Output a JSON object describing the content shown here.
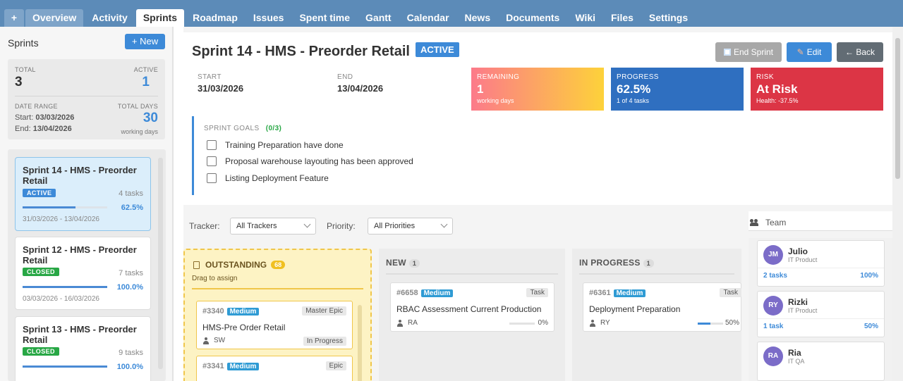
{
  "nav": {
    "plus": "+",
    "tabs": [
      "Overview",
      "Activity",
      "Sprints",
      "Roadmap",
      "Issues",
      "Spent time",
      "Gantt",
      "Calendar",
      "News",
      "Documents",
      "Wiki",
      "Files",
      "Settings"
    ]
  },
  "sidebar": {
    "title": "Sprints",
    "new_button": "+ New",
    "stats": {
      "total_label": "TOTAL",
      "total": "3",
      "active_label": "ACTIVE",
      "active": "1",
      "date_range_label": "DATE RANGE",
      "start_label": "Start:",
      "start": "03/03/2026",
      "end_label": "End:",
      "end": "13/04/2026",
      "total_days_label": "TOTAL DAYS",
      "total_days": "30",
      "working_days": "working days"
    },
    "sprints": [
      {
        "title": "Sprint 14 - HMS - Preorder Retail",
        "status": "ACTIVE",
        "tasks": "4 tasks",
        "progress": 62.5,
        "progress_text": "62.5%",
        "dates": "31/03/2026 - 13/04/2026"
      },
      {
        "title": "Sprint 12 - HMS - Preorder Retail",
        "status": "CLOSED",
        "tasks": "7 tasks",
        "progress": 100,
        "progress_text": "100.0%",
        "dates": "03/03/2026 - 16/03/2026"
      },
      {
        "title": "Sprint 13 - HMS - Preorder Retail",
        "status": "CLOSED",
        "tasks": "9 tasks",
        "progress": 100,
        "progress_text": "100.0%",
        "dates": ""
      }
    ]
  },
  "header": {
    "title": "Sprint 14 - HMS - Preorder Retail",
    "status": "ACTIVE",
    "end_sprint": "End Sprint",
    "edit": "Edit",
    "back": "← Back"
  },
  "info": {
    "start_label": "START",
    "start": "31/03/2026",
    "end_label": "END",
    "end": "13/04/2026",
    "remaining_label": "REMAINING",
    "remaining": "1",
    "remaining_sub": "working days",
    "progress_label": "PROGRESS",
    "progress": "62.5%",
    "progress_sub": "1 of 4 tasks",
    "risk_label": "RISK",
    "risk": "At Risk",
    "risk_sub": "Health: -37.5%"
  },
  "goals": {
    "label": "SPRINT GOALS",
    "count": "(0/3)",
    "items": [
      "Training Preparation have done",
      "Proposal warehouse layouting has been approved",
      "Listing Deployment Feature"
    ]
  },
  "filters": {
    "tracker_label": "Tracker:",
    "tracker": "All Trackers",
    "priority_label": "Priority:",
    "priority": "All Priorities"
  },
  "board": {
    "outstanding": {
      "title": "OUTSTANDING",
      "count": "68",
      "hint": "Drag to assign",
      "tasks": [
        {
          "id": "#3340",
          "priority": "Medium",
          "tracker": "Master Epic",
          "subject": "HMS-Pre Order Retail",
          "user": "SW",
          "status": "In Progress"
        },
        {
          "id": "#3341",
          "priority": "Medium",
          "tracker": "Epic"
        }
      ]
    },
    "new": {
      "title": "NEW",
      "count": "1",
      "task": {
        "id": "#6658",
        "priority": "Medium",
        "tracker": "Task",
        "subject": "RBAC Assessment Current Production",
        "user": "RA",
        "progress": 0,
        "progress_text": "0%"
      }
    },
    "in_progress": {
      "title": "IN PROGRESS",
      "count": "1",
      "task": {
        "id": "#6361",
        "priority": "Medium",
        "tracker": "Task",
        "subject": "Deployment Preparation",
        "user": "RY",
        "progress": 50,
        "progress_text": "50%"
      }
    }
  },
  "team": {
    "title": "Team",
    "members": [
      {
        "initials": "JM",
        "name": "Julio",
        "role": "IT Product",
        "tasks": "2 tasks",
        "pct": "100%"
      },
      {
        "initials": "RY",
        "name": "Rizki",
        "role": "IT Product",
        "tasks": "1 task",
        "pct": "50%"
      },
      {
        "initials": "RA",
        "name": "Ria",
        "role": "IT QA",
        "tasks": "",
        "pct": ""
      }
    ]
  },
  "colors": {
    "accent": "#3d8ad8",
    "nav": "#5c8bb8",
    "risk": "#dc3545",
    "progress": "#2f6fc0",
    "outstanding": "#fdf3c4"
  }
}
